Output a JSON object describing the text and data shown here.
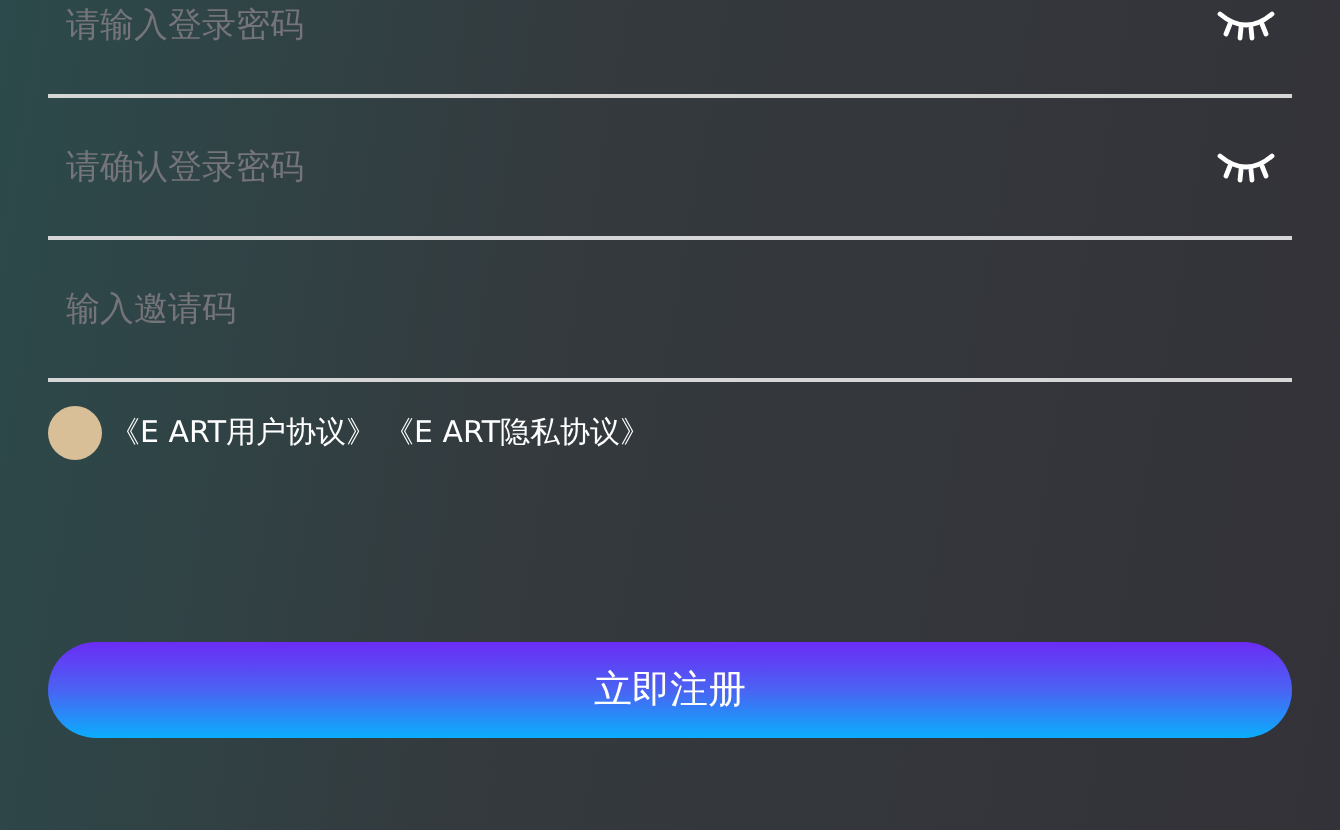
{
  "fields": [
    {
      "kind": "password",
      "placeholder": "请输入登录密码"
    },
    {
      "kind": "password",
      "placeholder": "请确认登录密码"
    },
    {
      "kind": "text",
      "placeholder": "输入邀请码"
    }
  ],
  "agreement": {
    "checked": false,
    "links": [
      "《E ART用户协议》",
      "《E ART隐私协议》"
    ]
  },
  "submit_button": "立即注册"
}
